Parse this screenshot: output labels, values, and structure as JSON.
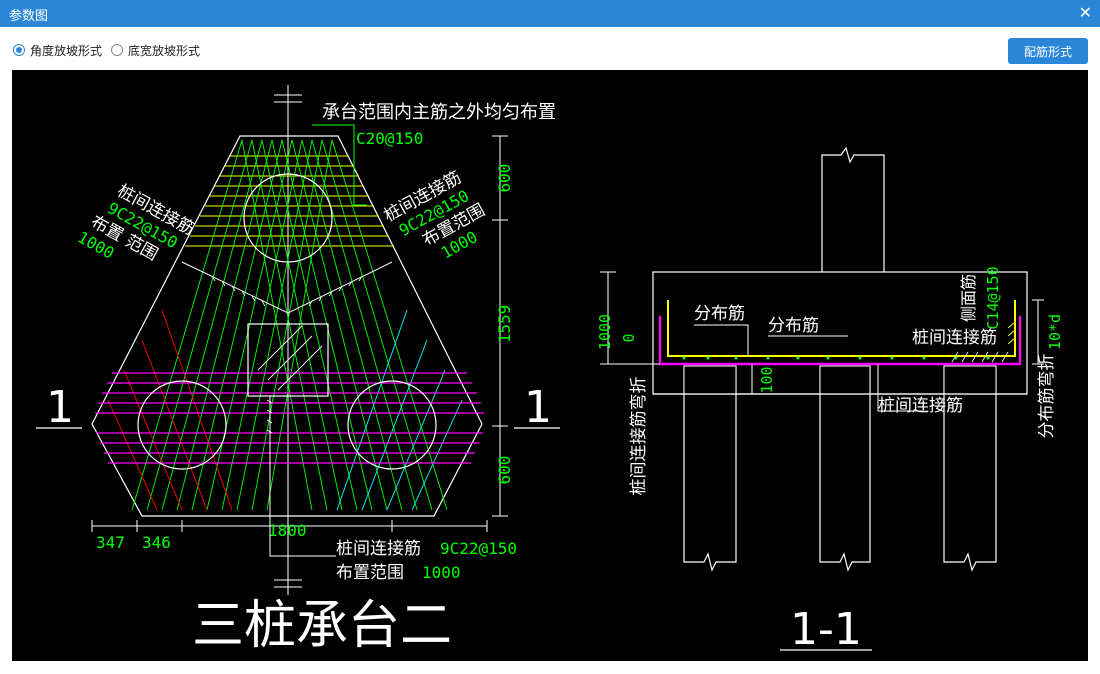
{
  "window": {
    "title": "参数图",
    "close_glyph": "✕"
  },
  "options": {
    "angle_mode": "角度放坡形式",
    "width_mode": "底宽放坡形式",
    "selected": "angle_mode"
  },
  "rebar_button": "配筋形式",
  "plan": {
    "top_note": "承台范围内主筋之外均匀布置",
    "top_spec": "C20@150",
    "left_label1": "桩间连接筋",
    "left_spec": "9C22@150",
    "left_label2": "布置 范围",
    "left_range": "1000",
    "right_label1": "桩间连接筋",
    "right_spec": "9C22@150",
    "right_label2": "布置范围",
    "right_range": "1000",
    "section_mark_left": "1",
    "section_mark_right": "1",
    "dim_top": "600",
    "dim_mid": "1559",
    "dim_bot": "600",
    "dim_a": "347",
    "dim_b": "346",
    "dim_width": "1800",
    "bottom_label1": "桩间连接筋",
    "bottom_spec": "9C22@150",
    "bottom_label2": "布置范围",
    "bottom_range": "1000",
    "title": "三桩承台二"
  },
  "section": {
    "dist_bar_1": "分布筋",
    "dist_bar_2": "分布筋",
    "side_bar": "侧面筋",
    "side_spec": "C14@150",
    "connect_bar_1": "桩间连接筋",
    "connect_bar_2": "桩间连接筋",
    "dim_height": "1000",
    "dim_zero": "0",
    "dim_100": "100",
    "dim_10d": "10*d",
    "left_vertical": "桩间连接筋弯折",
    "right_vertical": "分布筋弯折",
    "title": "1-1"
  },
  "colors": {
    "accent": "#2b86d9",
    "drawing_bg": "#000000",
    "green": "#00ff00",
    "yellow": "#ffff00",
    "magenta": "#ff00ff",
    "cyan": "#00ffff",
    "red": "#ff0000",
    "white": "#ffffff"
  }
}
